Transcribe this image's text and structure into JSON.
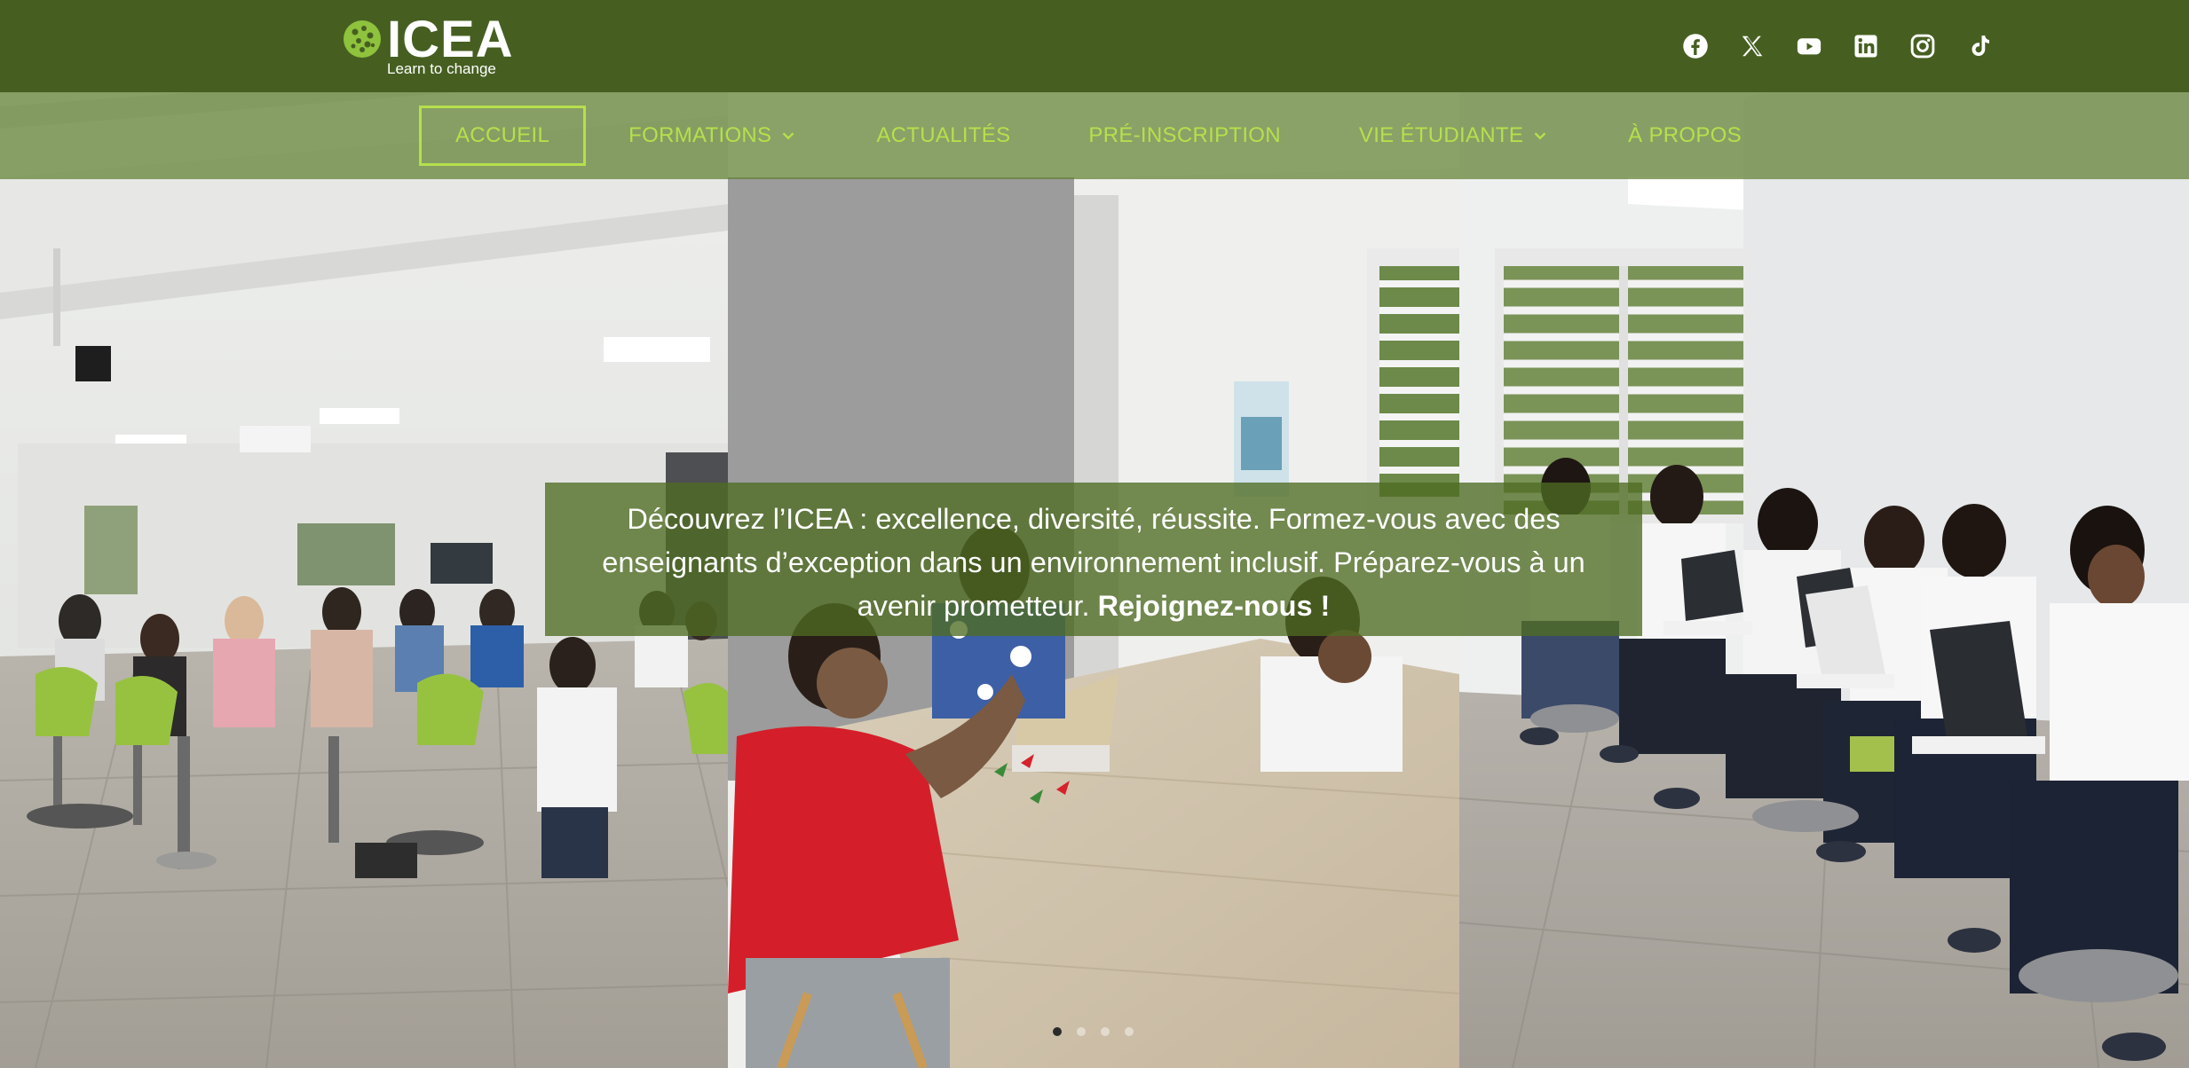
{
  "header": {
    "logo": {
      "word": "ICEA",
      "tagline": "Learn to change"
    },
    "socials": [
      {
        "icon": "facebook-icon"
      },
      {
        "icon": "x-icon"
      },
      {
        "icon": "youtube-icon"
      },
      {
        "icon": "linkedin-icon"
      },
      {
        "icon": "instagram-icon"
      },
      {
        "icon": "tiktok-icon"
      }
    ]
  },
  "nav": {
    "items": [
      {
        "label": "ACCUEIL",
        "active": true
      },
      {
        "label": "FORMATIONS",
        "dropdown": true
      },
      {
        "label": "ACTUALITÉS"
      },
      {
        "label": "PRÉ-INSCRIPTION"
      },
      {
        "label": "VIE ÉTUDIANTE",
        "dropdown": true
      },
      {
        "label": "À PROPOS"
      }
    ]
  },
  "hero": {
    "text": "Découvrez l’ICEA : excellence, diversité, réussite. Formez-vous avec des enseignants d’exception dans un environnement inclusif. Préparez-vous à un avenir prometteur.",
    "cta": "Rejoignez-nous !",
    "slides_total": 4,
    "active_slide": 1
  },
  "colors": {
    "header_bg": "#465f21",
    "nav_text": "#b5e04c",
    "accent": "#b5e04c",
    "white": "#ffffff"
  }
}
